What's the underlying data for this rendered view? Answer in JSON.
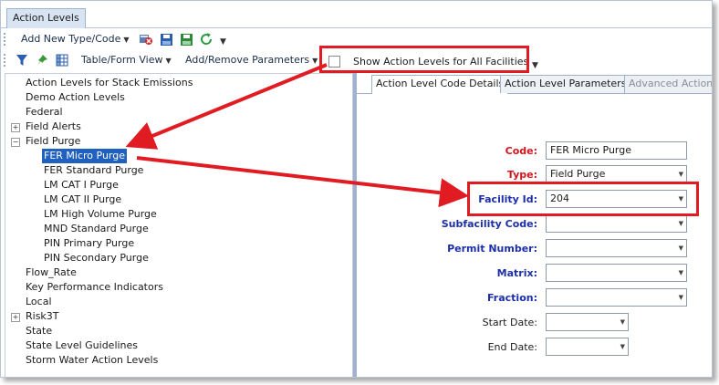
{
  "window": {
    "tab": "Action Levels"
  },
  "toolbar1": {
    "add_new": "Add New Type/Code",
    "icons": [
      "delete-icon",
      "save-icon",
      "save-all-icon",
      "refresh-icon"
    ]
  },
  "toolbar2": {
    "icons": [
      "filter-icon",
      "pin-icon",
      "grid-icon"
    ],
    "table_form_view": "Table/Form View",
    "add_remove_params": "Add/Remove Parameters",
    "show_all_facilities": "Show Action Levels for All Facilities"
  },
  "tree": {
    "items": [
      {
        "label": "Action Levels for Stack Emissions"
      },
      {
        "label": "Demo Action Levels"
      },
      {
        "label": "Federal"
      },
      {
        "label": "Field Alerts",
        "expander": "+"
      },
      {
        "label": "Field Purge",
        "expander": "−"
      },
      {
        "label": "FER Micro Purge",
        "selected": true
      },
      {
        "label": "FER Standard Purge"
      },
      {
        "label": "LM CAT I Purge"
      },
      {
        "label": "LM CAT II Purge"
      },
      {
        "label": "LM High Volume Purge"
      },
      {
        "label": "MND Standard Purge"
      },
      {
        "label": "PIN Primary Purge"
      },
      {
        "label": "PIN Secondary Purge"
      },
      {
        "label": "Flow_Rate"
      },
      {
        "label": "Key Performance Indicators"
      },
      {
        "label": "Local"
      },
      {
        "label": "Risk3T",
        "expander": "+"
      },
      {
        "label": "State"
      },
      {
        "label": "State Level Guidelines"
      },
      {
        "label": "Storm Water Action Levels"
      }
    ]
  },
  "right": {
    "tabs": [
      "Action Level Code Details",
      "Action Level Parameters",
      "Advanced Action"
    ],
    "form": {
      "code_label": "Code:",
      "code_value": "FER Micro Purge",
      "type_label": "Type:",
      "type_value": "Field Purge",
      "facility_label": "Facility Id:",
      "facility_value": "204",
      "subfacility_label": "Subfacility Code:",
      "permit_label": "Permit Number:",
      "matrix_label": "Matrix:",
      "fraction_label": "Fraction:",
      "start_label": "Start Date:",
      "end_label": "End Date:"
    }
  },
  "colors": {
    "highlight": "#e11b22",
    "selection": "#2060c0",
    "required_label": "#d4141d",
    "optional_label": "#1c2fa8"
  }
}
